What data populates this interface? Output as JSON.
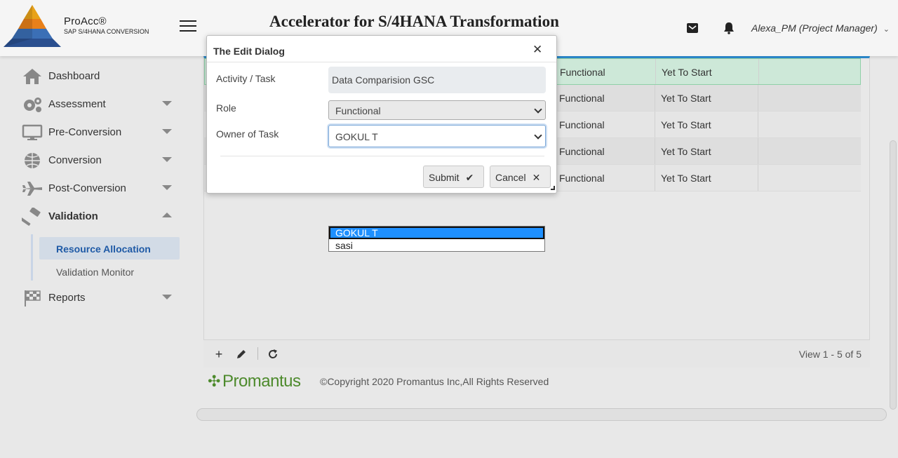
{
  "brand": {
    "name": "ProAcc®",
    "subtitle": "SAP S/4HANA CONVERSION"
  },
  "header": {
    "title": "Accelerator for S/4HANA Transformation",
    "user": "Alexa_PM (Project Manager)"
  },
  "sidebar": {
    "items": [
      {
        "label": "Dashboard",
        "icon": "home-icon"
      },
      {
        "label": "Assessment",
        "icon": "gears-icon"
      },
      {
        "label": "Pre-Conversion",
        "icon": "monitor-icon"
      },
      {
        "label": "Conversion",
        "icon": "globe-icon"
      },
      {
        "label": "Post-Conversion",
        "icon": "plane-icon"
      },
      {
        "label": "Validation",
        "icon": "gavel-icon"
      },
      {
        "label": "Reports",
        "icon": "flag-icon"
      }
    ],
    "validation_subitems": [
      "Resource Allocation",
      "Validation Monitor"
    ]
  },
  "grid": {
    "rows": [
      {
        "role": "Functional",
        "status": "Yet To Start",
        "owner": ""
      },
      {
        "role": "Functional",
        "status": "Yet To Start",
        "owner": ""
      },
      {
        "role": "Functional",
        "status": "Yet To Start",
        "owner": ""
      },
      {
        "role": "Functional",
        "status": "Yet To Start",
        "owner": ""
      },
      {
        "role": "Functional",
        "status": "Yet To Start",
        "owner": ""
      }
    ],
    "pager_info": "View 1 - 5 of 5"
  },
  "footer": {
    "company": "Promantus",
    "copyright": "©Copyright 2020 Promantus Inc,All Rights Reserved"
  },
  "dialog": {
    "title": "The Edit Dialog",
    "activity_label": "Activity / Task",
    "activity_value": "Data Comparision GSC",
    "role_label": "Role",
    "role_value": "Functional",
    "owner_label": "Owner of Task",
    "owner_value": "GOKUL T",
    "owner_options": [
      "GOKUL T",
      "sasi"
    ],
    "submit_label": "Submit",
    "cancel_label": "Cancel"
  },
  "colors": {
    "accent": "#2d8fd5",
    "selected_row": "#cde8d8",
    "brand_green": "#4d8a2c",
    "dropdown_highlight": "#1e90ff"
  }
}
